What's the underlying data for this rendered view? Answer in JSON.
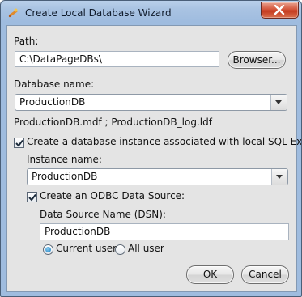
{
  "window": {
    "title": "Create Local Database Wizard",
    "icon": "wizard-app-icon",
    "close_icon": "close-icon"
  },
  "path": {
    "label": "Path:",
    "value": "C:\\DataPageDBs\\",
    "browse_label": "Browser..."
  },
  "database": {
    "label": "Database name:",
    "value": "ProductionDB",
    "files_text": "ProductionDB.mdf ;  ProductionDB_log.ldf"
  },
  "instance": {
    "checkbox_label": "Create a database instance associated with local SQL Express:",
    "checked": true,
    "name_label": "Instance name:",
    "name_value": "ProductionDB"
  },
  "odbc": {
    "checkbox_label": "Create an ODBC Data Source:",
    "checked": true,
    "dsn_label": "Data Source Name (DSN):",
    "dsn_value": "ProductionDB",
    "scope_options": [
      "Current user",
      "All user"
    ],
    "scope_selected": "Current user"
  },
  "buttons": {
    "ok": "OK",
    "cancel": "Cancel"
  },
  "colors": {
    "title_bar": "#a9c3e2",
    "close_button": "#c43a1f",
    "client_bg": "#e4e4e4",
    "radio_accent": "#1d7fc0"
  }
}
